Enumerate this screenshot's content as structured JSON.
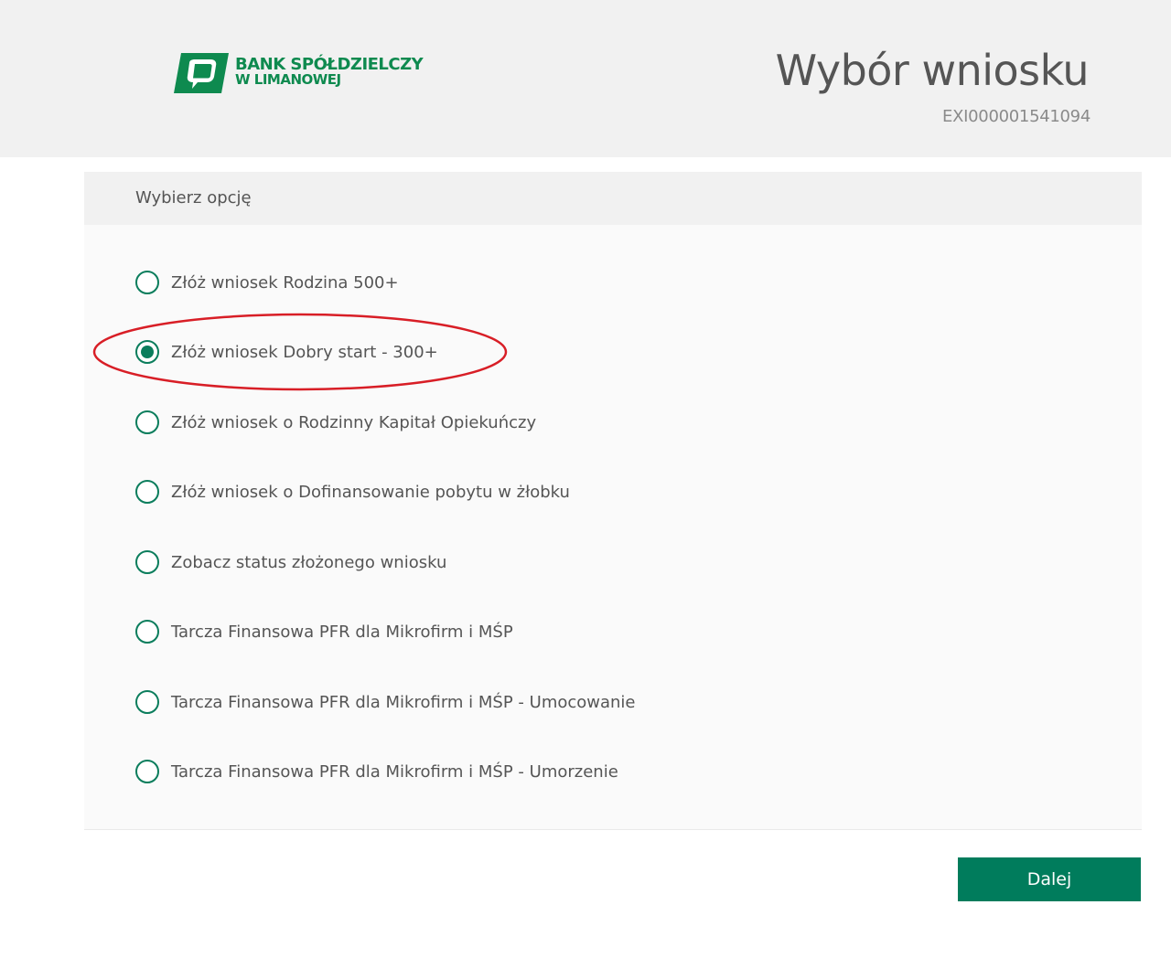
{
  "header": {
    "logo": {
      "line1": "BANK SPÓŁDZIELCZY",
      "line2": "W LIMANOWEJ"
    },
    "title": "Wybór wniosku",
    "request_id": "EXI000001541094"
  },
  "panel": {
    "title": "Wybierz opcję",
    "options": [
      {
        "label": "Złóż wniosek Rodzina 500+",
        "checked": false
      },
      {
        "label": "Złóż wniosek Dobry start - 300+",
        "checked": true
      },
      {
        "label": "Złóż wniosek o Rodzinny Kapitał Opiekuńczy",
        "checked": false
      },
      {
        "label": "Złóż wniosek o Dofinansowanie pobytu w żłobku",
        "checked": false
      },
      {
        "label": "Zobacz status złożonego wniosku",
        "checked": false
      },
      {
        "label": "Tarcza Finansowa PFR dla Mikrofirm i MŚP",
        "checked": false
      },
      {
        "label": "Tarcza Finansowa PFR dla Mikrofirm i MŚP - Umocowanie",
        "checked": false
      },
      {
        "label": "Tarcza Finansowa PFR dla Mikrofirm i MŚP - Umorzenie",
        "checked": false
      }
    ]
  },
  "actions": {
    "next_label": "Dalej"
  },
  "colors": {
    "brand_green": "#0e8a4f",
    "radio_green": "#0b7d5c",
    "button_green": "#007c5c",
    "annotation_red": "#d81e26"
  }
}
